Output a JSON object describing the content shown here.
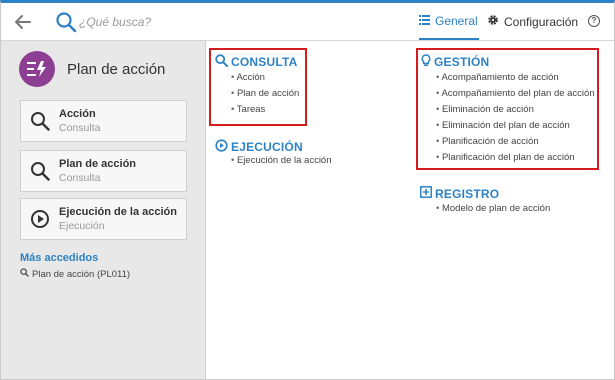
{
  "topbar": {
    "search_placeholder": "¿Qué busca?",
    "tabs": [
      {
        "label": "General",
        "icon": "list-icon",
        "active": true
      },
      {
        "label": "Configuración",
        "icon": "gear-icon",
        "active": false
      }
    ],
    "help": "?"
  },
  "sidebar": {
    "app_title": "Plan de acción",
    "app_color": "#8d3f93",
    "cards": [
      {
        "title": "Acción",
        "subtitle": "Consulta",
        "icon": "search-icon"
      },
      {
        "title": "Plan de acción",
        "subtitle": "Consulta",
        "icon": "search-icon"
      },
      {
        "title": "Ejecución de la acción",
        "subtitle": "Ejecución",
        "icon": "play-circle-icon"
      }
    ],
    "most_accessed_title": "Más accedidos",
    "most_accessed": [
      {
        "label": "Plan de acción (PL011)",
        "icon": "search-icon"
      }
    ]
  },
  "sections": {
    "consulta": {
      "title": "CONSULTA",
      "icon": "search-icon",
      "items": [
        "Acción",
        "Plan de acción",
        "Tareas"
      ]
    },
    "ejecucion": {
      "title": "EJECUCIÓN",
      "icon": "play-circle-icon",
      "items": [
        "Ejecución de la acción"
      ]
    },
    "gestion": {
      "title": "GESTIÓN",
      "icon": "lightbulb-icon",
      "items": [
        "Acompañamiento de acción",
        "Acompañamiento del plan de acción",
        "Eliminación de acción",
        "Eliminación del plan de acción",
        "Planificación de acción",
        "Planificación del plan de acción"
      ]
    },
    "registro": {
      "title": "REGISTRO",
      "icon": "plus-square-icon",
      "items": [
        "Modelo de plan de acción"
      ]
    }
  },
  "colors": {
    "accent": "#2d82c6",
    "highlight": "#d51c1c"
  }
}
